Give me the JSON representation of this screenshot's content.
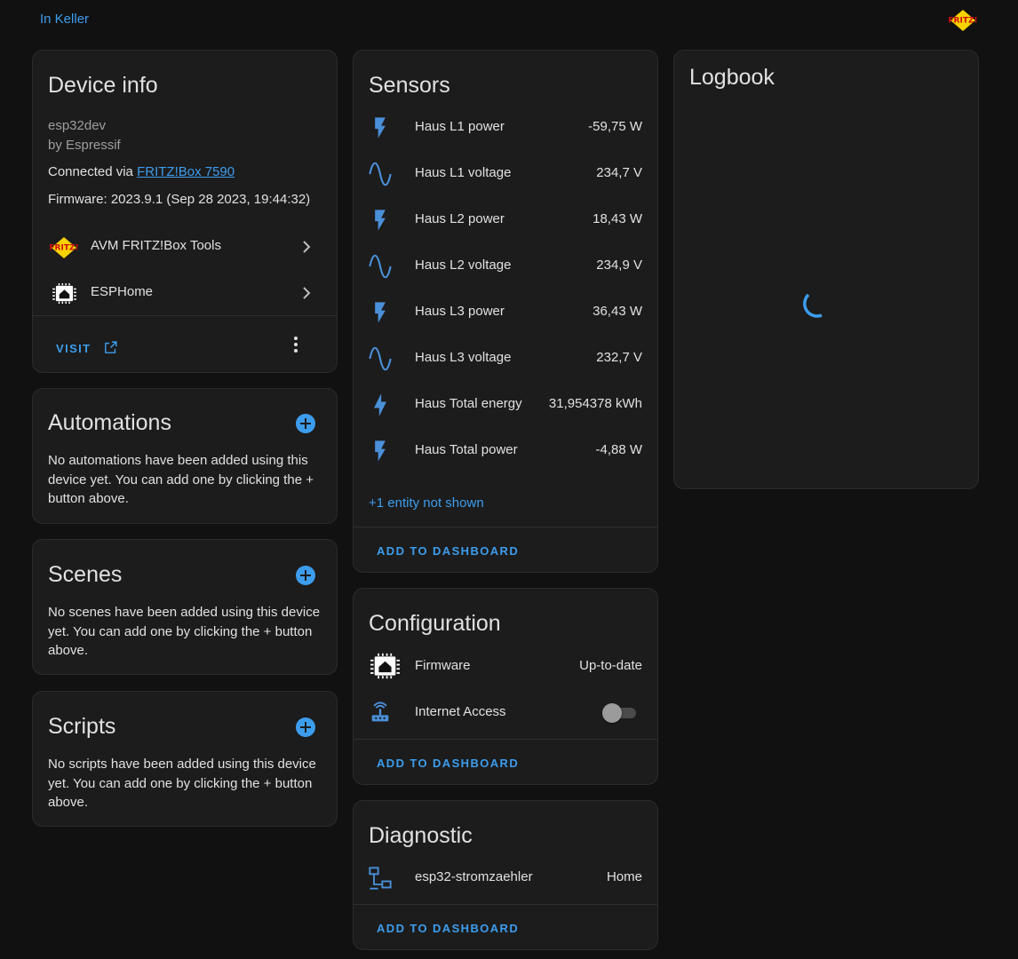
{
  "header": {
    "area_link": "In Keller",
    "logo_icon": "fritz-logo-icon"
  },
  "colors": {
    "background": "#111111",
    "card": "#1c1c1c",
    "accent": "#3d9ded",
    "text": "#e1e1e1",
    "muted": "#9e9e9e",
    "icon": "#4a90d9"
  },
  "device_info": {
    "title": "Device info",
    "model": "esp32dev",
    "manufacturer": "by Espressif",
    "connected_prefix": "Connected via ",
    "connected_link": "FRITZ!Box 7590",
    "firmware": "Firmware: 2023.9.1 (Sep 28 2023, 19:44:32)",
    "integrations": [
      {
        "label": "AVM FRITZ!Box Tools",
        "icon": "fritz-logo-icon"
      },
      {
        "label": "ESPHome",
        "icon": "esphome-icon"
      }
    ],
    "visit_label": "VISIT"
  },
  "automations": {
    "title": "Automations",
    "empty_text": "No automations have been added using this device yet. You can add one by clicking the + button above."
  },
  "scenes": {
    "title": "Scenes",
    "empty_text": "No scenes have been added using this device yet. You can add one by clicking the + button above."
  },
  "scripts": {
    "title": "Scripts",
    "empty_text": "No scripts have been added using this device yet. You can add one by clicking the + button above."
  },
  "sensors": {
    "title": "Sensors",
    "items": [
      {
        "label": "Haus L1 power",
        "value": "-59,75 W",
        "icon": "flash-icon"
      },
      {
        "label": "Haus L1 voltage",
        "value": "234,7 V",
        "icon": "sine-wave-icon"
      },
      {
        "label": "Haus L2 power",
        "value": "18,43 W",
        "icon": "flash-icon"
      },
      {
        "label": "Haus L2 voltage",
        "value": "234,9 V",
        "icon": "sine-wave-icon"
      },
      {
        "label": "Haus L3 power",
        "value": "36,43 W",
        "icon": "flash-icon"
      },
      {
        "label": "Haus L3 voltage",
        "value": "232,7 V",
        "icon": "sine-wave-icon"
      },
      {
        "label": "Haus Total energy",
        "value": "31,954378 kWh",
        "icon": "lightning-bolt-icon"
      },
      {
        "label": "Haus Total power",
        "value": "-4,88 W",
        "icon": "flash-icon"
      }
    ],
    "more_entities": "+1 entity not shown",
    "add_label": "ADD TO DASHBOARD"
  },
  "configuration": {
    "title": "Configuration",
    "items": [
      {
        "label": "Firmware",
        "value": "Up-to-date",
        "icon": "esphome-icon"
      },
      {
        "label": "Internet Access",
        "icon": "router-wireless-icon",
        "toggle_on": false
      }
    ],
    "add_label": "ADD TO DASHBOARD"
  },
  "diagnostic": {
    "title": "Diagnostic",
    "items": [
      {
        "label": "esp32-stromzaehler",
        "value": "Home",
        "icon": "lan-icon"
      }
    ],
    "add_label": "ADD TO DASHBOARD"
  },
  "logbook": {
    "title": "Logbook",
    "loading_icon": "spinner-icon"
  }
}
